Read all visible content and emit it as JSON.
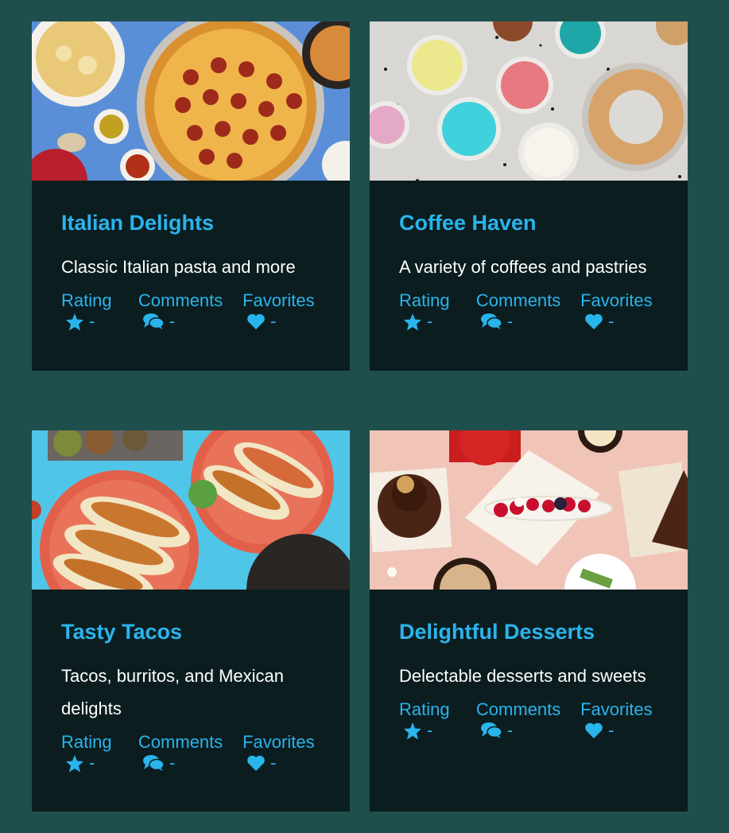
{
  "colors": {
    "background": "#1f4f4d",
    "card": "#0b1d1f",
    "accent": "#2ab4ec",
    "text": "#ffffff"
  },
  "icons": {
    "rating": "star-icon",
    "comments": "comments-icon",
    "favorites": "heart-icon"
  },
  "cards": [
    {
      "title": "Italian Delights",
      "description": "Classic Italian pasta and more",
      "image": "pizza-photo",
      "stats": {
        "rating_label": "Rating",
        "rating_value": "-",
        "comments_label": "Comments",
        "comments_value": "-",
        "favorites_label": "Favorites",
        "favorites_value": "-"
      }
    },
    {
      "title": "Coffee Haven",
      "description": "A variety of coffees and pastries",
      "image": "desserts-dips-photo",
      "stats": {
        "rating_label": "Rating",
        "rating_value": "-",
        "comments_label": "Comments",
        "comments_value": "-",
        "favorites_label": "Favorites",
        "favorites_value": "-"
      }
    },
    {
      "title": "Tasty Tacos",
      "description": "Tacos, burritos, and Mexican delights",
      "image": "tacos-photo",
      "stats": {
        "rating_label": "Rating",
        "rating_value": "-",
        "comments_label": "Comments",
        "comments_value": "-",
        "favorites_label": "Favorites",
        "favorites_value": "-"
      }
    },
    {
      "title": "Delightful Desserts",
      "description": "Delectable desserts and sweets",
      "image": "pastries-photo",
      "stats": {
        "rating_label": "Rating",
        "rating_value": "-",
        "comments_label": "Comments",
        "comments_value": "-",
        "favorites_label": "Favorites",
        "favorites_value": "-"
      }
    }
  ]
}
